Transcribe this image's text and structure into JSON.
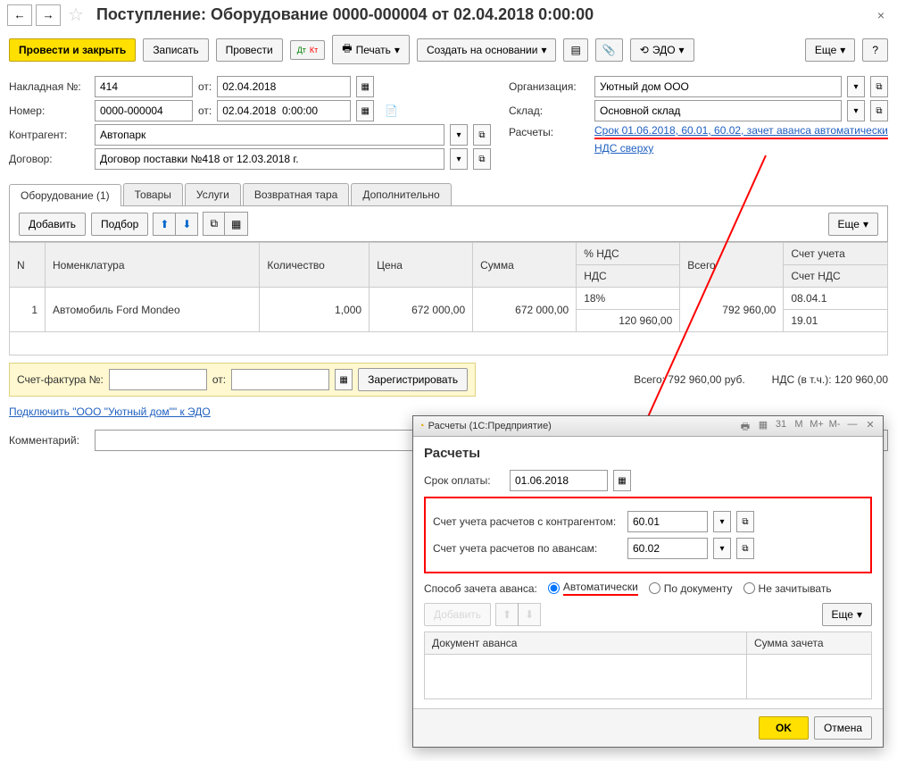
{
  "header": {
    "title": "Поступление: Оборудование 0000-000004 от 02.04.2018 0:00:00"
  },
  "actions": {
    "post_close": "Провести и закрыть",
    "save": "Записать",
    "post": "Провести",
    "print": "Печать",
    "create_based": "Создать на основании",
    "edo": "ЭДО",
    "more": "Еще",
    "help": "?"
  },
  "form": {
    "invoice_no_label": "Накладная №:",
    "invoice_no": "414",
    "from_label": "от:",
    "invoice_date": "02.04.2018",
    "number_label": "Номер:",
    "number": "0000-000004",
    "number_date": "02.04.2018  0:00:00",
    "contragent_label": "Контрагент:",
    "contragent": "Автопарк",
    "contract_label": "Договор:",
    "contract": "Договор поставки №418 от 12.03.2018 г.",
    "org_label": "Организация:",
    "org": "Уютный дом ООО",
    "warehouse_label": "Склад:",
    "warehouse": "Основной склад",
    "calc_label": "Расчеты:",
    "calc_link": "Срок 01.06.2018, 60.01, 60.02, зачет аванса автоматически",
    "vat_link": "НДС сверху"
  },
  "tabs": {
    "equipment": "Оборудование (1)",
    "goods": "Товары",
    "services": "Услуги",
    "containers": "Возвратная тара",
    "extra": "Дополнительно"
  },
  "table_toolbar": {
    "add": "Добавить",
    "pick": "Подбор",
    "more": "Еще"
  },
  "table": {
    "cols": {
      "n": "N",
      "nom": "Номенклатура",
      "qty": "Количество",
      "price": "Цена",
      "sum": "Сумма",
      "vat_pct": "% НДС",
      "vat": "НДС",
      "total": "Всего",
      "acct": "Счет учета",
      "acct_vat": "Счет НДС"
    },
    "row": {
      "n": "1",
      "nom": "Автомобиль Ford Mondeo",
      "qty": "1,000",
      "price": "672 000,00",
      "sum": "672 000,00",
      "vat_pct": "18%",
      "vat": "120 960,00",
      "total": "792 960,00",
      "acct": "08.04.1",
      "acct_vat": "19.01"
    }
  },
  "invoice": {
    "label": "Счет-фактура №:",
    "from": "от:",
    "register": "Зарегистрировать"
  },
  "totals": {
    "total_label": "Всего:",
    "total": "792 960,00",
    "rub": "руб.",
    "vat_label": "НДС (в т.ч.):",
    "vat": "120 960,00"
  },
  "edo_link": "Подключить \"ООО \"Уютный дом\"\" к ЭДО",
  "comment_label": "Комментарий:",
  "popup": {
    "titlebar": "Расчеты  (1С:Предприятие)",
    "title": "Расчеты",
    "due_label": "Срок оплаты:",
    "due": "01.06.2018",
    "acct_counterparty_label": "Счет учета расчетов с контрагентом:",
    "acct_counterparty": "60.01",
    "acct_advance_label": "Счет учета расчетов по авансам:",
    "acct_advance": "60.02",
    "offset_label": "Способ зачета аванса:",
    "opt_auto": "Автоматически",
    "opt_bydoc": "По документу",
    "opt_none": "Не зачитывать",
    "add": "Добавить",
    "more": "Еще",
    "col_doc": "Документ аванса",
    "col_sum": "Сумма зачета",
    "ok": "OK",
    "cancel": "Отмена"
  }
}
